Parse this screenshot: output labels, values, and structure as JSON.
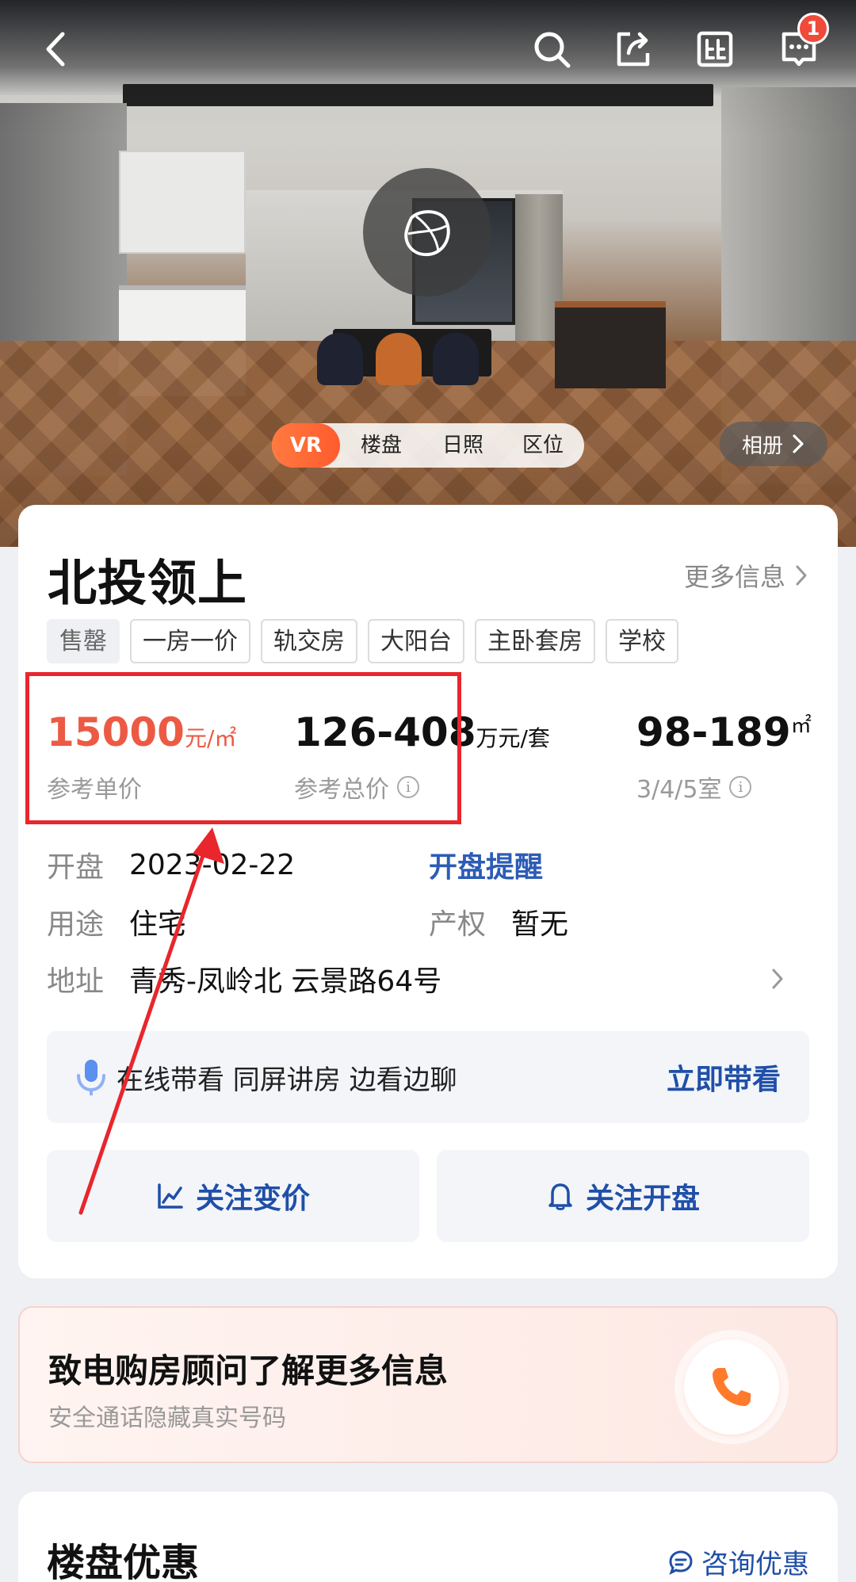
{
  "hero": {
    "tabs": [
      "VR",
      "楼盘",
      "日照",
      "区位"
    ],
    "album_label": "相册",
    "message_badge": "1"
  },
  "project": {
    "name": "北投领上",
    "more_info": "更多信息",
    "status_tag": "售罄",
    "tags": [
      "一房一价",
      "轨交房",
      "大阳台",
      "主卧套房",
      "学校"
    ]
  },
  "prices": {
    "unit_price": "15000",
    "unit_price_unit": "元/㎡",
    "unit_price_label": "参考单价",
    "total_price": "126-408",
    "total_price_unit": "万元/套",
    "total_price_label": "参考总价",
    "area": "98-189",
    "area_unit": "㎡",
    "rooms_label": "3/4/5室"
  },
  "details": {
    "open_label": "开盘",
    "open_date": "2023-02-22",
    "open_remind": "开盘提醒",
    "usage_label": "用途",
    "usage_value": "住宅",
    "property_label": "产权",
    "property_value": "暂无",
    "address_label": "地址",
    "address_value": "青秀-凤岭北 云景路64号"
  },
  "live_view": {
    "text": "在线带看  同屏讲房 边看边聊",
    "action": "立即带看"
  },
  "follow": {
    "price_label": "关注变价",
    "open_label": "关注开盘"
  },
  "call": {
    "title": "致电购房顾问了解更多信息",
    "subtitle": "安全通话隐藏真实号码"
  },
  "promo": {
    "title": "楼盘优惠",
    "consult": "咨询优惠"
  },
  "colors": {
    "accent_orange": "#ff6a35",
    "price_red": "#ec5a44",
    "link_blue": "#1f4fa8",
    "annotation_red": "#e8262c"
  }
}
